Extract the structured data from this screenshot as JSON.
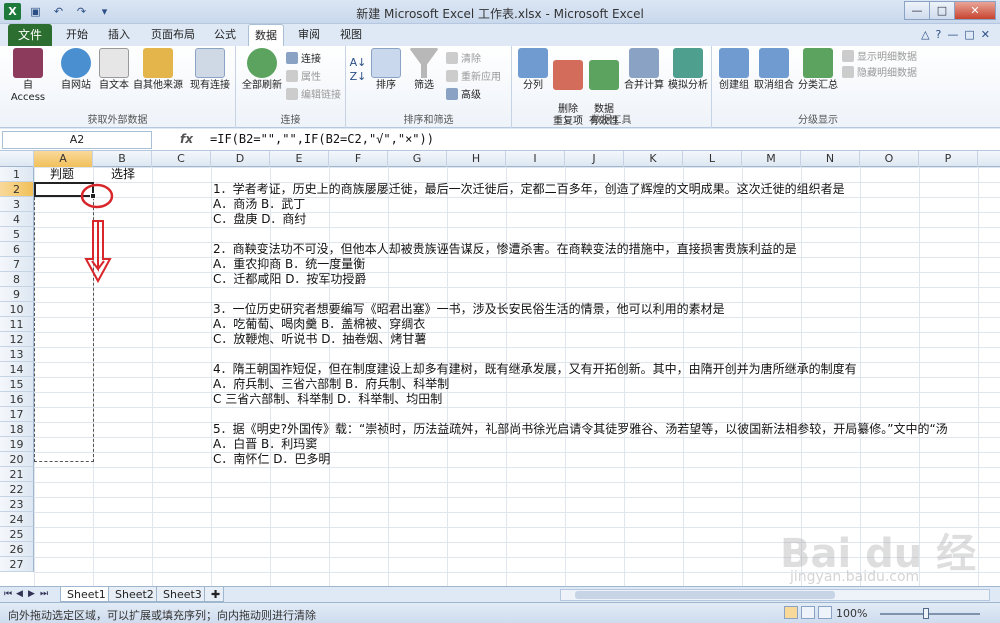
{
  "window": {
    "title": "新建 Microsoft Excel 工作表.xlsx - Microsoft Excel",
    "controls": [
      "—",
      "□",
      "✕"
    ]
  },
  "ribbon_tabs": {
    "file": "文件",
    "tabs": [
      "开始",
      "插入",
      "页面布局",
      "公式",
      "数据",
      "审阅",
      "视图"
    ],
    "active": "数据"
  },
  "ribbon": {
    "groups": [
      {
        "label": "获取外部数据",
        "buttons": [
          "自 Access",
          "自网站",
          "自文本",
          "自其他来源",
          "现有连接"
        ]
      },
      {
        "label": "连接",
        "buttons": [
          "全部刷新"
        ],
        "small": [
          "连接",
          "属性",
          "编辑链接"
        ]
      },
      {
        "label": "排序和筛选",
        "buttons": [
          "排序",
          "筛选"
        ],
        "small": [
          "清除",
          "重新应用",
          "高级"
        ]
      },
      {
        "label": "数据工具",
        "buttons": [
          "分列",
          "删除\n重复项",
          "数据\n有效性",
          "合并计算",
          "模拟分析"
        ]
      },
      {
        "label": "分级显示",
        "buttons": [
          "创建组",
          "取消组合",
          "分类汇总"
        ],
        "small": [
          "显示明细数据",
          "隐藏明细数据"
        ]
      }
    ]
  },
  "formula_bar": {
    "name_box": "A2",
    "fx": "fx",
    "formula": "=IF(B2=\"\",\"\",IF(B2=C2,\"√\",\"×\"))"
  },
  "grid": {
    "columns": [
      "A",
      "B",
      "C",
      "D",
      "E",
      "F",
      "G",
      "H",
      "I",
      "J",
      "K",
      "L",
      "M",
      "N",
      "O",
      "P"
    ],
    "rows": [
      "1",
      "2",
      "3",
      "4",
      "5",
      "6",
      "7",
      "8",
      "9",
      "10",
      "11",
      "12",
      "13",
      "14",
      "15",
      "16",
      "17",
      "18",
      "19",
      "20",
      "21",
      "22",
      "23",
      "24",
      "25",
      "26",
      "27"
    ],
    "cells": {
      "A1": "判题",
      "B1": "选择",
      "D2": "1．学者考证，历史上的商族屡屡迁徙，最后一次迁徙后，定都二百多年，创造了辉煌的文明成果。这次迁徙的组织者是",
      "D3": "A．商汤 B．武丁",
      "D4": "C．盘庚 D．商纣",
      "D6": "2．商鞅变法功不可没，但他本人却被贵族诬告谋反，惨遭杀害。在商鞅变法的措施中，直接损害贵族利益的是",
      "D7": "A．重农抑商 B．统一度量衡",
      "D8": "C．迁都咸阳 D．按军功授爵",
      "D10": "3．一位历史研究者想要编写《昭君出塞》一书，涉及长安民俗生活的情景，他可以利用的素材是",
      "D11": "A．吃葡萄、喝肉羹 B．盖棉被、穿绸衣",
      "D12": "C．放鞭炮、听说书 D．抽卷烟、烤甘薯",
      "D14": "4．隋王朝国祚短促，但在制度建设上却多有建树，既有继承发展，又有开拓创新。其中，由隋开创并为唐所继承的制度有",
      "D15": "A．府兵制、三省六部制 B．府兵制、科举制",
      "D16": "C 三省六部制、科举制 D．科举制、均田制",
      "D18": "5．据《明史?外国传》载：“崇祯时，历法益疏舛，礼部尚书徐光启请令其徒罗雅谷、汤若望等，以彼国新法相参较，开局纂修。”文中的“汤",
      "D19": "A．白晋 B．利玛窦",
      "D20": "C．南怀仁 D．巴多明"
    }
  },
  "sheets": {
    "tabs": [
      "Sheet1",
      "Sheet2",
      "Sheet3"
    ],
    "active": "Sheet1"
  },
  "status": {
    "text": "向外拖动选定区域，可以扩展或填充序列；向内拖动则进行清除",
    "zoom": "100%"
  },
  "watermark": {
    "brand": "Bai du 经验",
    "url": "jingyan.baidu.com"
  },
  "colors": {
    "file_tab": "#2b6e2f",
    "selection_header": "#f1c05a",
    "annotation_red": "#d9262b"
  }
}
